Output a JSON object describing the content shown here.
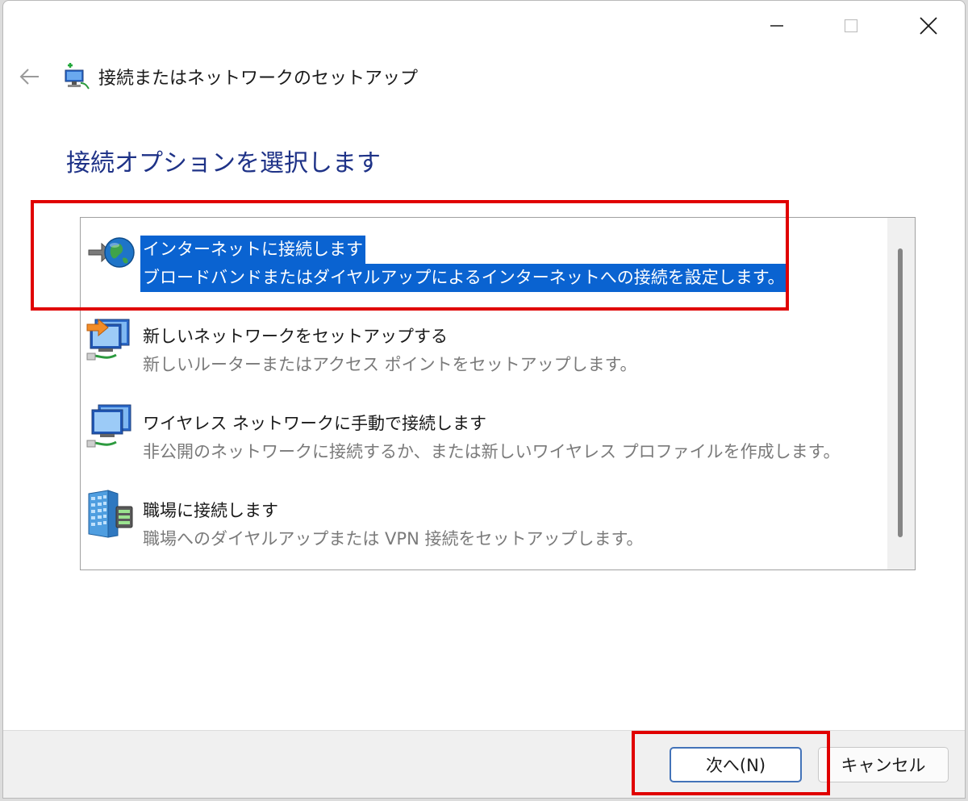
{
  "window": {
    "title": "接続またはネットワークのセットアップ",
    "heading": "接続オプションを選択します"
  },
  "options": [
    {
      "title": "インターネットに接続します",
      "description": "ブロードバンドまたはダイヤルアップによるインターネットへの接続を設定します。",
      "icon": "globe-connection-icon",
      "selected": true
    },
    {
      "title": "新しいネットワークをセットアップする",
      "description": "新しいルーターまたはアクセス ポイントをセットアップします。",
      "icon": "network-setup-icon",
      "selected": false
    },
    {
      "title": "ワイヤレス ネットワークに手動で接続します",
      "description": "非公開のネットワークに接続するか、または新しいワイヤレス プロファイルを作成します。",
      "icon": "wireless-network-icon",
      "selected": false
    },
    {
      "title": "職場に接続します",
      "description": "職場へのダイヤルアップまたは VPN 接続をセットアップします。",
      "icon": "workplace-building-icon",
      "selected": false
    }
  ],
  "buttons": {
    "next": "次へ(N)",
    "cancel": "キャンセル"
  },
  "colors": {
    "heading": "#1e3287",
    "selection": "#0a63d1",
    "annotation": "#e00000",
    "next_border": "#4373b8"
  }
}
